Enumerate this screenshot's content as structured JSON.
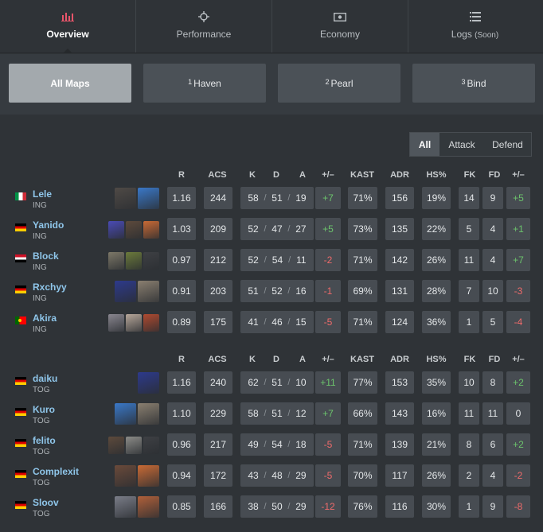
{
  "tabs": [
    {
      "label": "Overview",
      "soon": "",
      "active": true,
      "icon": "bar-chart-icon"
    },
    {
      "label": "Performance",
      "soon": "",
      "active": false,
      "icon": "crosshair-icon"
    },
    {
      "label": "Economy",
      "soon": "",
      "active": false,
      "icon": "cash-icon"
    },
    {
      "label": "Logs",
      "soon": "(Soon)",
      "active": false,
      "icon": "list-icon"
    }
  ],
  "maps": [
    {
      "num": "",
      "label": "All Maps",
      "active": true
    },
    {
      "num": "1",
      "label": "Haven",
      "active": false
    },
    {
      "num": "2",
      "label": "Pearl",
      "active": false
    },
    {
      "num": "3",
      "label": "Bind",
      "active": false
    }
  ],
  "side_filter": [
    "All",
    "Attack",
    "Defend"
  ],
  "side_filter_active": "All",
  "columns": [
    "R",
    "ACS",
    "K",
    "D",
    "A",
    "+/–",
    "KAST",
    "ADR",
    "HS%",
    "FK",
    "FD",
    "+/–"
  ],
  "colors": {
    "positive": "#6cc36c",
    "negative": "#ef6b6b",
    "player_name": "#8fc6ea"
  },
  "teams": [
    {
      "name": "ING",
      "players": [
        {
          "name": "Lele",
          "team": "ING",
          "flag": "it",
          "agents": [
            "#4f4a46",
            "#3a78c8"
          ],
          "r": "1.16",
          "acs": "244",
          "k": "58",
          "d": "51",
          "a": "19",
          "kd": "+7",
          "kast": "71%",
          "adr": "156",
          "hs": "19%",
          "fk": "14",
          "fd": "9",
          "fkfd": "+5"
        },
        {
          "name": "Yanido",
          "team": "ING",
          "flag": "de",
          "agents": [
            "#4a4bb5",
            "#5d4a3c",
            "#c96a35"
          ],
          "r": "1.03",
          "acs": "209",
          "k": "52",
          "d": "47",
          "a": "27",
          "kd": "+5",
          "kast": "73%",
          "adr": "135",
          "hs": "22%",
          "fk": "5",
          "fd": "4",
          "fkfd": "+1"
        },
        {
          "name": "Block",
          "team": "ING",
          "flag": "eg",
          "agents": [
            "#7d7868",
            "#6b7a3b",
            "#3e4044"
          ],
          "r": "0.97",
          "acs": "212",
          "k": "52",
          "d": "54",
          "a": "11",
          "kd": "-2",
          "kast": "71%",
          "adr": "142",
          "hs": "26%",
          "fk": "11",
          "fd": "4",
          "fkfd": "+7"
        },
        {
          "name": "Rxchyy",
          "team": "ING",
          "flag": "de",
          "agents": [
            "#2d3a8c",
            "#8a7f70"
          ],
          "r": "0.91",
          "acs": "203",
          "k": "51",
          "d": "52",
          "a": "16",
          "kd": "-1",
          "kast": "69%",
          "adr": "131",
          "hs": "28%",
          "fk": "7",
          "fd": "10",
          "fkfd": "-3"
        },
        {
          "name": "Akira",
          "team": "ING",
          "flag": "pt",
          "agents": [
            "#8a8790",
            "#b7a79a",
            "#b04a30"
          ],
          "r": "0.89",
          "acs": "175",
          "k": "41",
          "d": "46",
          "a": "15",
          "kd": "-5",
          "kast": "71%",
          "adr": "124",
          "hs": "36%",
          "fk": "1",
          "fd": "5",
          "fkfd": "-4"
        }
      ]
    },
    {
      "name": "TOG",
      "players": [
        {
          "name": "daiku",
          "team": "TOG",
          "flag": "de",
          "agents": [
            "#2d3a8c"
          ],
          "r": "1.16",
          "acs": "240",
          "k": "62",
          "d": "51",
          "a": "10",
          "kd": "+11",
          "kast": "77%",
          "adr": "153",
          "hs": "35%",
          "fk": "10",
          "fd": "8",
          "fkfd": "+2"
        },
        {
          "name": "Kuro",
          "team": "TOG",
          "flag": "de",
          "agents": [
            "#3a78c8",
            "#8a7f70"
          ],
          "r": "1.10",
          "acs": "229",
          "k": "58",
          "d": "51",
          "a": "12",
          "kd": "+7",
          "kast": "66%",
          "adr": "143",
          "hs": "16%",
          "fk": "11",
          "fd": "11",
          "fkfd": "0"
        },
        {
          "name": "felito",
          "team": "TOG",
          "flag": "de",
          "agents": [
            "#5d4a3c",
            "#8c8c88",
            "#3e4044"
          ],
          "r": "0.96",
          "acs": "217",
          "k": "49",
          "d": "54",
          "a": "18",
          "kd": "-5",
          "kast": "71%",
          "adr": "139",
          "hs": "21%",
          "fk": "8",
          "fd": "6",
          "fkfd": "+2"
        },
        {
          "name": "Complexit",
          "team": "TOG",
          "flag": "de",
          "agents": [
            "#6a4a3a",
            "#c96a35"
          ],
          "r": "0.94",
          "acs": "172",
          "k": "43",
          "d": "48",
          "a": "29",
          "kd": "-5",
          "kast": "70%",
          "adr": "117",
          "hs": "26%",
          "fk": "2",
          "fd": "4",
          "fkfd": "-2"
        },
        {
          "name": "Sloov",
          "team": "TOG",
          "flag": "de",
          "agents": [
            "#7a7d88",
            "#b0603a"
          ],
          "r": "0.85",
          "acs": "166",
          "k": "38",
          "d": "50",
          "a": "29",
          "kd": "-12",
          "kast": "76%",
          "adr": "116",
          "hs": "30%",
          "fk": "1",
          "fd": "9",
          "fkfd": "-8"
        }
      ]
    }
  ]
}
